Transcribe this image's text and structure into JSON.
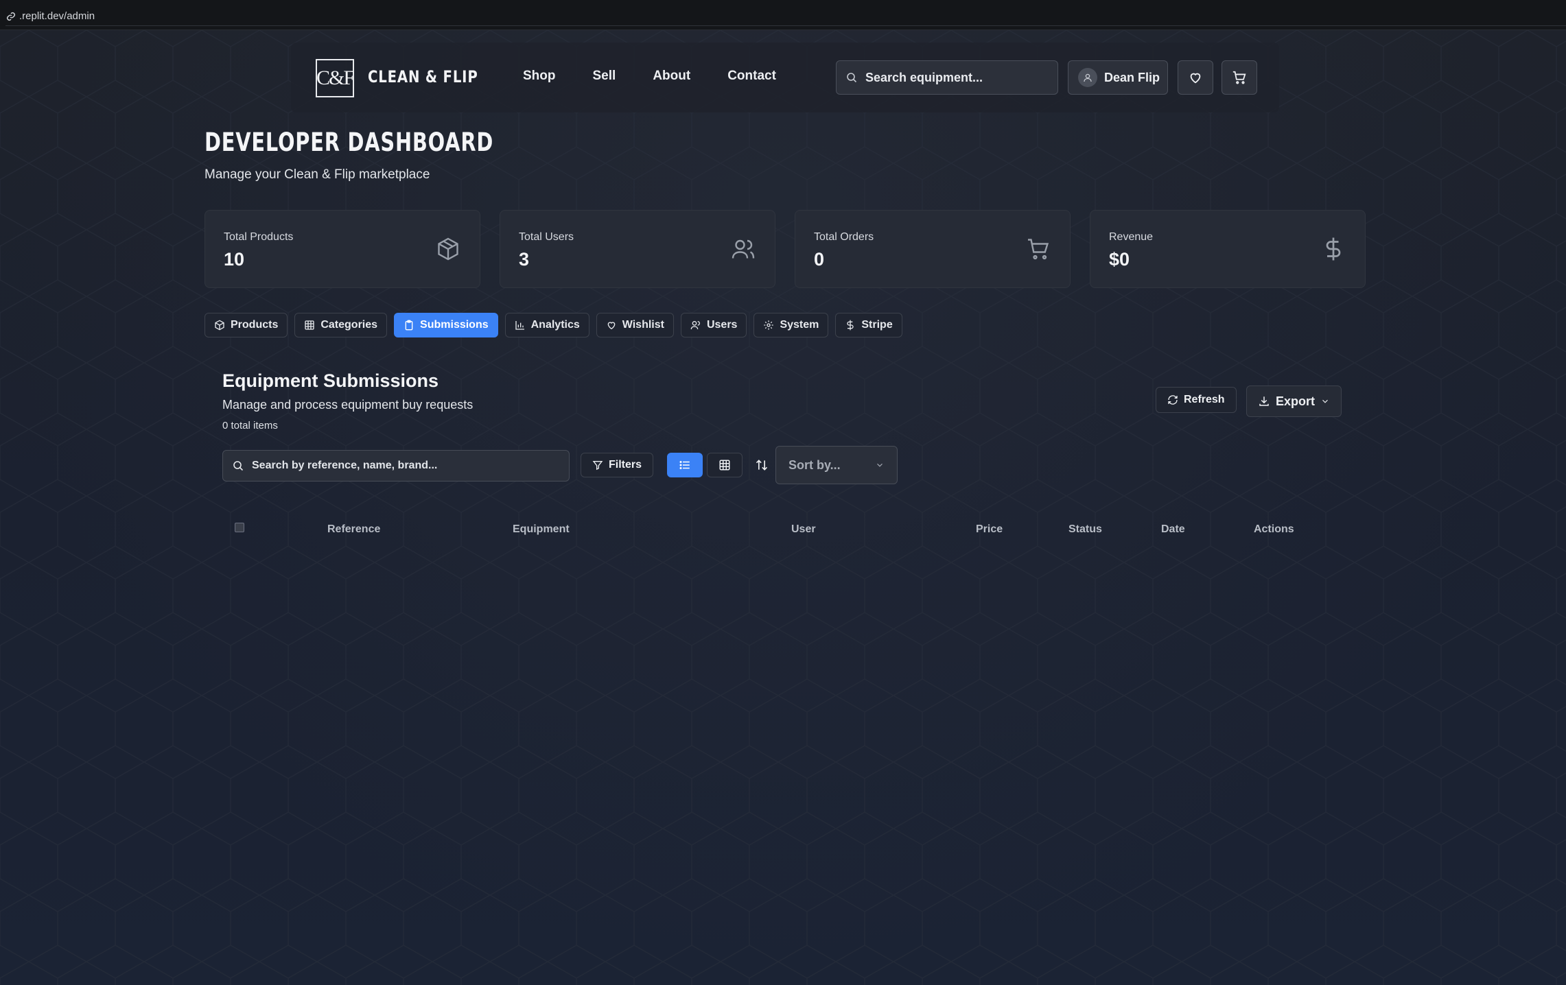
{
  "browser": {
    "url": ".replit.dev/admin"
  },
  "nav": {
    "logo_text": "C&F",
    "brand": "CLEAN & FLIP",
    "links": [
      "Shop",
      "Sell",
      "About",
      "Contact"
    ],
    "search_placeholder": "Search equipment...",
    "user_name": "Dean Flip"
  },
  "header": {
    "title": "DEVELOPER DASHBOARD",
    "subtitle": "Manage your Clean & Flip marketplace"
  },
  "stats": [
    {
      "label": "Total Products",
      "value": "10",
      "icon": "package-icon"
    },
    {
      "label": "Total Users",
      "value": "3",
      "icon": "users-icon"
    },
    {
      "label": "Total Orders",
      "value": "0",
      "icon": "cart-icon"
    },
    {
      "label": "Revenue",
      "value": "$0",
      "icon": "dollar-icon"
    }
  ],
  "tabs": [
    {
      "label": "Products",
      "icon": "package-icon",
      "active": false
    },
    {
      "label": "Categories",
      "icon": "grid-icon",
      "active": false
    },
    {
      "label": "Submissions",
      "icon": "clipboard-icon",
      "active": true
    },
    {
      "label": "Analytics",
      "icon": "bar-chart-icon",
      "active": false
    },
    {
      "label": "Wishlist",
      "icon": "heart-icon",
      "active": false
    },
    {
      "label": "Users",
      "icon": "users-icon",
      "active": false
    },
    {
      "label": "System",
      "icon": "gear-icon",
      "active": false
    },
    {
      "label": "Stripe",
      "icon": "dollar-icon",
      "active": false
    }
  ],
  "section": {
    "title": "Equipment Submissions",
    "subtitle": "Manage and process equipment buy requests",
    "count": "0 total items",
    "refresh_label": "Refresh",
    "export_label": "Export",
    "search_placeholder": "Search by reference, name, brand...",
    "filters_label": "Filters",
    "sort_placeholder": "Sort by..."
  },
  "table": {
    "columns": [
      "Reference",
      "Equipment",
      "User",
      "Price",
      "Status",
      "Date",
      "Actions"
    ]
  },
  "colors": {
    "accent": "#3b82f6",
    "background": "#1b2130"
  }
}
